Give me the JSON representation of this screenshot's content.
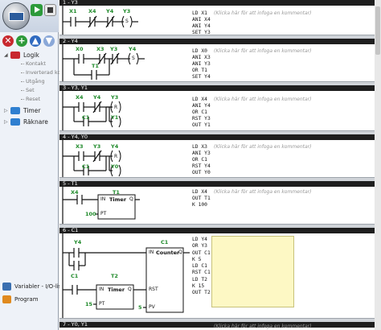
{
  "left_tree": {
    "logik": {
      "label": "Logik",
      "children": [
        "Kontakt",
        "Inverterad kont",
        "Utgång",
        "Set",
        "Reset"
      ]
    },
    "timer": {
      "label": "Timer"
    },
    "raknare": {
      "label": "Räknare"
    }
  },
  "bottom_nav": [
    {
      "label": "Variabler - I/O-lista"
    },
    {
      "label": "Program"
    }
  ],
  "comment_placeholder": "(Klicka här för att infoga en kommentar)",
  "rungs": [
    {
      "header": "1 - Y3",
      "labels": [
        "X1",
        "X4",
        "Y4",
        "Y3"
      ],
      "coil": "S",
      "il": [
        "LD X1",
        "ANI X4",
        "ANI Y4",
        "SET Y3"
      ]
    },
    {
      "header": "2 - Y4",
      "labels": [
        "X0",
        "X3",
        "Y3",
        "Y4",
        "T1"
      ],
      "coil": "S",
      "il": [
        "LD X0",
        "ANI X3",
        "ANI Y3",
        "OR T1",
        "SET Y4"
      ]
    },
    {
      "header": "3 - Y3, Y1",
      "labels": [
        "X4",
        "Y4",
        "C1",
        "Y3",
        "Y1"
      ],
      "coil": "R",
      "il": [
        "LD X4",
        "ANI Y4",
        "OR C1",
        "RST Y3",
        "OUT Y1"
      ]
    },
    {
      "header": "4 - Y4, Y0",
      "labels": [
        "X3",
        "Y3",
        "C1",
        "Y4",
        "Y0"
      ],
      "coil": "R",
      "il": [
        "LD X3",
        "ANI Y3",
        "OR C1",
        "RST Y4",
        "OUT Y0"
      ]
    },
    {
      "header": "5 - T1",
      "labels": [
        "X4",
        "T1"
      ],
      "box": {
        "title": "Timer",
        "in": "IN",
        "q": "Q",
        "pt": "PT",
        "preset": "100"
      },
      "il": [
        "LD X4",
        "OUT T1",
        "K 100"
      ]
    },
    {
      "header": "6 - C1",
      "labels": [
        "Y4",
        "C1",
        "C1",
        "T2"
      ],
      "counter": {
        "title": "Counter",
        "in": "IN",
        "q": "Q",
        "rst": "RST",
        "pv": "PV",
        "preset": "5"
      },
      "timer2": {
        "title": "Timer",
        "in": "IN",
        "q": "Q",
        "pt": "PT",
        "preset": "15"
      },
      "il": [
        "LD Y4",
        "OR Y3",
        "OUT C1",
        "K 5",
        "LD C1",
        "RST C1",
        "LD T2",
        "K 15",
        "OUT T2"
      ]
    },
    {
      "header": "7 - Y0, Y1"
    }
  ]
}
